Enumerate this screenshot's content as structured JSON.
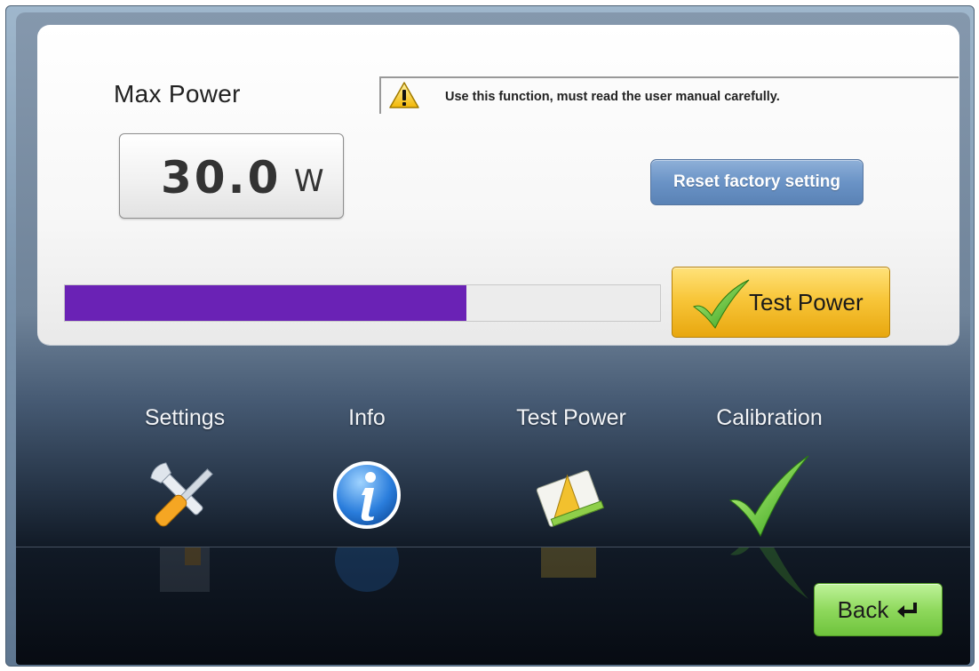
{
  "max_power": {
    "label": "Max Power",
    "value": "30.0",
    "unit": "W"
  },
  "warning": {
    "icon": "warning-triangle-icon",
    "text": "Use this function, must read the user manual carefully."
  },
  "reset_button": {
    "label": "Reset factory setting"
  },
  "progress": {
    "fraction": 0.675,
    "color": "#6a22b5"
  },
  "test_power_button": {
    "label": "Test Power",
    "icon": "checkmark-icon"
  },
  "nav": [
    {
      "label": "Settings",
      "icon": "tools-icon"
    },
    {
      "label": "Info",
      "icon": "info-icon"
    },
    {
      "label": "Test Power",
      "icon": "ruler-icon"
    },
    {
      "label": "Calibration",
      "icon": "checkmark-icon"
    }
  ],
  "back_button": {
    "label": "Back",
    "icon": "return-arrow-icon"
  },
  "colors": {
    "accent_blue": "#6a93c6",
    "accent_yellow": "#f8c63a",
    "accent_green": "#8fd95d",
    "progress_purple": "#6a22b5"
  }
}
